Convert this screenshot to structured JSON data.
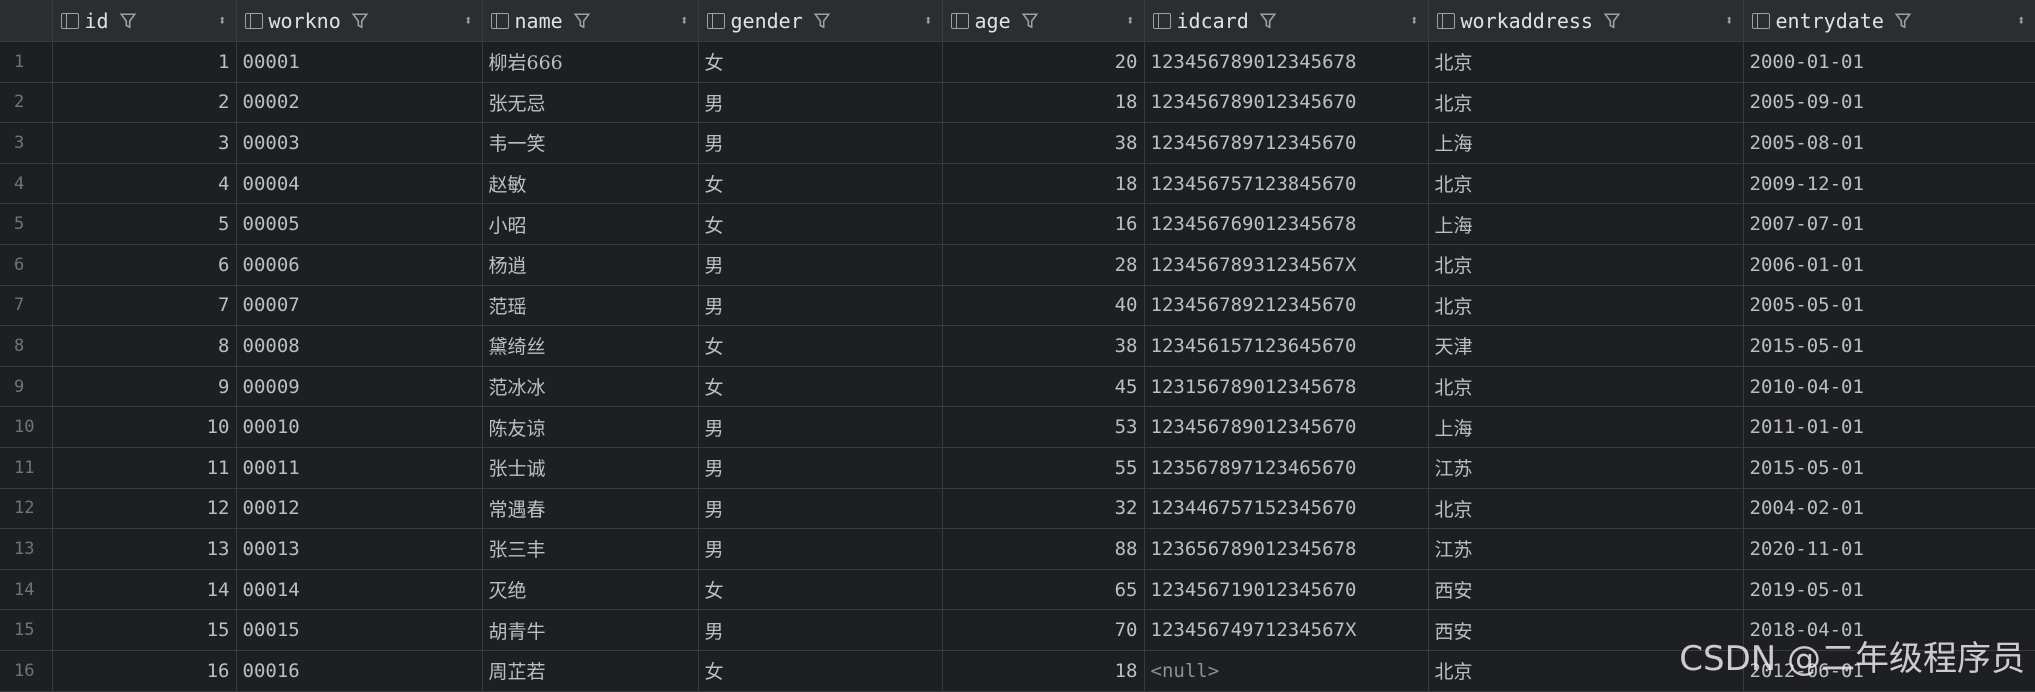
{
  "columns": [
    "id",
    "workno",
    "name",
    "gender",
    "age",
    "idcard",
    "workaddress",
    "entrydate"
  ],
  "rows": [
    {
      "rownum": "1",
      "id": "1",
      "workno": "00001",
      "name": "柳岩666",
      "gender": "女",
      "age": "20",
      "idcard": "123456789012345678",
      "workaddress": "北京",
      "entrydate": "2000-01-01"
    },
    {
      "rownum": "2",
      "id": "2",
      "workno": "00002",
      "name": "张无忌",
      "gender": "男",
      "age": "18",
      "idcard": "123456789012345670",
      "workaddress": "北京",
      "entrydate": "2005-09-01"
    },
    {
      "rownum": "3",
      "id": "3",
      "workno": "00003",
      "name": "韦一笑",
      "gender": "男",
      "age": "38",
      "idcard": "123456789712345670",
      "workaddress": "上海",
      "entrydate": "2005-08-01"
    },
    {
      "rownum": "4",
      "id": "4",
      "workno": "00004",
      "name": "赵敏",
      "gender": "女",
      "age": "18",
      "idcard": "123456757123845670",
      "workaddress": "北京",
      "entrydate": "2009-12-01"
    },
    {
      "rownum": "5",
      "id": "5",
      "workno": "00005",
      "name": "小昭",
      "gender": "女",
      "age": "16",
      "idcard": "123456769012345678",
      "workaddress": "上海",
      "entrydate": "2007-07-01"
    },
    {
      "rownum": "6",
      "id": "6",
      "workno": "00006",
      "name": "杨逍",
      "gender": "男",
      "age": "28",
      "idcard": "12345678931234567X",
      "workaddress": "北京",
      "entrydate": "2006-01-01"
    },
    {
      "rownum": "7",
      "id": "7",
      "workno": "00007",
      "name": "范瑶",
      "gender": "男",
      "age": "40",
      "idcard": "123456789212345670",
      "workaddress": "北京",
      "entrydate": "2005-05-01"
    },
    {
      "rownum": "8",
      "id": "8",
      "workno": "00008",
      "name": "黛绮丝",
      "gender": "女",
      "age": "38",
      "idcard": "123456157123645670",
      "workaddress": "天津",
      "entrydate": "2015-05-01"
    },
    {
      "rownum": "9",
      "id": "9",
      "workno": "00009",
      "name": "范冰冰",
      "gender": "女",
      "age": "45",
      "idcard": "123156789012345678",
      "workaddress": "北京",
      "entrydate": "2010-04-01"
    },
    {
      "rownum": "10",
      "id": "10",
      "workno": "00010",
      "name": "陈友谅",
      "gender": "男",
      "age": "53",
      "idcard": "123456789012345670",
      "workaddress": "上海",
      "entrydate": "2011-01-01"
    },
    {
      "rownum": "11",
      "id": "11",
      "workno": "00011",
      "name": "张士诚",
      "gender": "男",
      "age": "55",
      "idcard": "123567897123465670",
      "workaddress": "江苏",
      "entrydate": "2015-05-01"
    },
    {
      "rownum": "12",
      "id": "12",
      "workno": "00012",
      "name": "常遇春",
      "gender": "男",
      "age": "32",
      "idcard": "123446757152345670",
      "workaddress": "北京",
      "entrydate": "2004-02-01"
    },
    {
      "rownum": "13",
      "id": "13",
      "workno": "00013",
      "name": "张三丰",
      "gender": "男",
      "age": "88",
      "idcard": "123656789012345678",
      "workaddress": "江苏",
      "entrydate": "2020-11-01"
    },
    {
      "rownum": "14",
      "id": "14",
      "workno": "00014",
      "name": "灭绝",
      "gender": "女",
      "age": "65",
      "idcard": "123456719012345670",
      "workaddress": "西安",
      "entrydate": "2019-05-01"
    },
    {
      "rownum": "15",
      "id": "15",
      "workno": "00015",
      "name": "胡青牛",
      "gender": "男",
      "age": "70",
      "idcard": "12345674971234567X",
      "workaddress": "西安",
      "entrydate": "2018-04-01"
    },
    {
      "rownum": "16",
      "id": "16",
      "workno": "00016",
      "name": "周芷若",
      "gender": "女",
      "age": "18",
      "idcard": "<null>",
      "workaddress": "北京",
      "entrydate": "2012-06-01"
    }
  ],
  "watermark": "CSDN @二年级程序员",
  "colors": {
    "background": "#1e1f22",
    "header": "#2b2d30",
    "grid": "#393b40",
    "text": "#bcbec4"
  },
  "icons": {
    "column": "column-icon",
    "filter": "filter-icon",
    "sort": "sort-icon"
  }
}
